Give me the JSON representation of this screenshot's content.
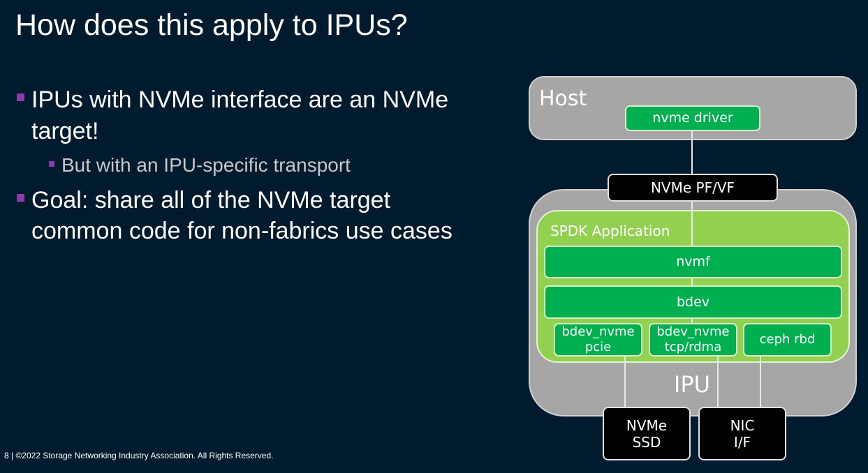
{
  "title": "How does this apply to IPUs?",
  "bullets": [
    {
      "text": "IPUs with NVMe interface are an NVMe",
      "text2": "target!",
      "sub": "But with an IPU-specific transport"
    },
    {
      "text": "Goal: share all of the NVMe target",
      "text2": "common code for non-fabrics use cases"
    }
  ],
  "diagram": {
    "host": "Host",
    "nvme_driver": "nvme driver",
    "pf_vf": "NVMe PF/VF",
    "spdk": "SPDK Application",
    "nvmf": "nvmf",
    "bdev": "bdev",
    "mod1a": "bdev_nvme",
    "mod1b": "pcie",
    "mod2a": "bdev_nvme",
    "mod2b": "tcp/rdma",
    "mod3": "ceph rbd",
    "ipu": "IPU",
    "ssd_a": "NVMe",
    "ssd_b": "SSD",
    "nic_a": "NIC",
    "nic_b": "I/F"
  },
  "footer": "8 | ©2022 Storage Networking Industry Association. All Rights Reserved.",
  "colors": {
    "background": "#001a2e",
    "bullet": "#8a3ca8",
    "green": "#00b050",
    "light_green": "#92d050",
    "gray": "#a6a6a6"
  }
}
